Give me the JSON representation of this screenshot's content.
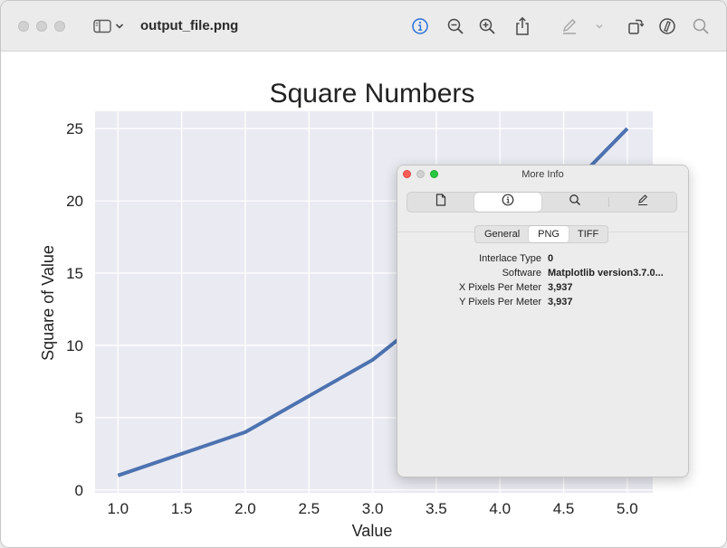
{
  "window": {
    "title": "output_file.png"
  },
  "toolbar": {
    "icons": [
      "sidebar-icon",
      "chevron-down-icon",
      "info-icon",
      "zoom-out-icon",
      "zoom-in-icon",
      "share-icon",
      "markup-icon",
      "chevron-down-icon",
      "rotate-icon",
      "annotate-icon",
      "search-icon"
    ],
    "accent": "#2a6fdb"
  },
  "chart_data": {
    "type": "line",
    "title": "Square Numbers",
    "xlabel": "Value",
    "ylabel": "Square of Value",
    "x": [
      1,
      2,
      3,
      4,
      5
    ],
    "series": [
      {
        "values": [
          1,
          4,
          9,
          16,
          25
        ],
        "color": "#4c72b0"
      }
    ],
    "xlim": [
      0.82,
      5.2
    ],
    "ylim": [
      -0.2,
      26.2
    ],
    "xticks": [
      "1.0",
      "1.5",
      "2.0",
      "2.5",
      "3.0",
      "3.5",
      "4.0",
      "4.5",
      "5.0"
    ],
    "yticks": [
      "0",
      "5",
      "10",
      "15",
      "20",
      "25"
    ],
    "style": "seaborn darkgrid",
    "grid": true,
    "background": "#eaeaf2"
  },
  "more_info": {
    "title": "More Info",
    "segment_icons": [
      "document-icon",
      "info-icon",
      "search-icon",
      "pencil-icon"
    ],
    "tabs": [
      "General",
      "PNG",
      "TIFF"
    ],
    "selected_tab": "PNG",
    "rows": [
      {
        "label": "Interlace Type",
        "value": "0"
      },
      {
        "label": "Software",
        "value": "Matplotlib version3.7.0..."
      },
      {
        "label": "X Pixels Per Meter",
        "value": "3,937"
      },
      {
        "label": "Y Pixels Per Meter",
        "value": "3,937"
      }
    ]
  }
}
